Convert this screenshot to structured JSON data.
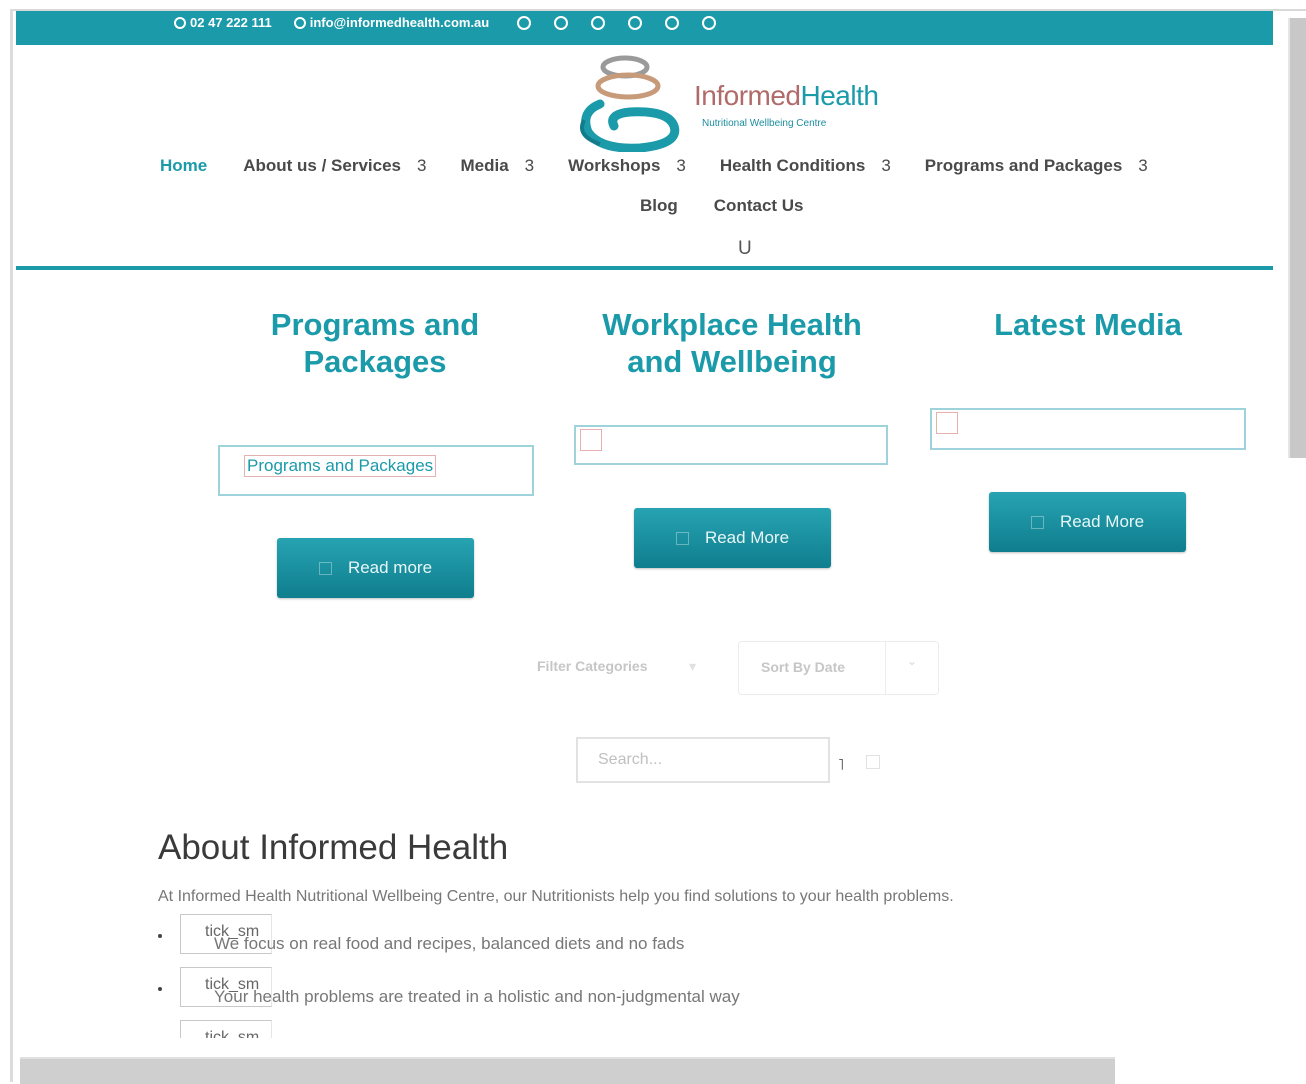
{
  "topbar": {
    "phone": "02 47 222 111",
    "email": "info@informedhealth.com.au",
    "social_icons": [
      "social-icon-1",
      "social-icon-2",
      "social-icon-3",
      "social-icon-4",
      "social-icon-5",
      "social-icon-6"
    ]
  },
  "logo": {
    "name_part1": "Informed",
    "name_part2": "Health",
    "tagline": "Nutritional Wellbeing Centre"
  },
  "nav": {
    "home": "Home",
    "about": "About us / Services",
    "media": "Media",
    "workshops": "Workshops",
    "health_conditions": "Health Conditions",
    "programs": "Programs and Packages",
    "caret": "3",
    "blog": "Blog",
    "contact": "Contact Us",
    "mobile_toggle": "U"
  },
  "features": [
    {
      "title": "Programs and Packages",
      "image_alt": "Programs and Packages",
      "button": "Read more"
    },
    {
      "title": "Workplace Health and Wellbeing",
      "image_alt": "",
      "button": "Read More"
    },
    {
      "title": "Latest Media",
      "image_alt": "",
      "button": "Read More"
    }
  ],
  "filters": {
    "filter_label": "Filter Categories",
    "sort_label": "Sort By Date"
  },
  "search": {
    "placeholder": "Search...",
    "tick": "˥"
  },
  "about": {
    "heading": "About Informed Health",
    "intro": "At Informed Health Nutritional Wellbeing Centre, our Nutritionists help you find solutions to your health problems.",
    "tick_alt": "tick_sm",
    "bullets": [
      "We focus on real food and recipes, balanced diets and no fads",
      "Your health problems are treated in a holistic and non-judgmental way"
    ]
  },
  "colors": {
    "brand": "#1b9aaa",
    "button": "#0f7e8e"
  }
}
